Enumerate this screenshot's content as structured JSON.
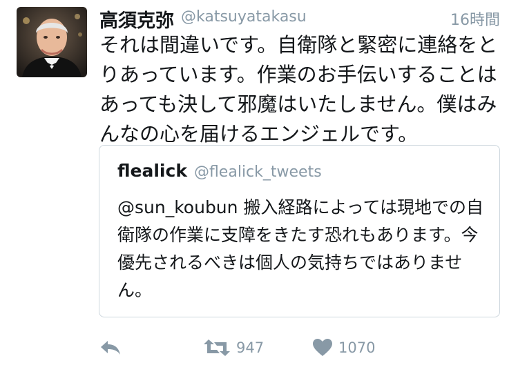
{
  "tweet": {
    "display_name": "高須克弥",
    "screen_name": "@katsuyatakasu",
    "timestamp": "16時間",
    "text": "それは間違いです。自衛隊と緊密に連絡をとりあっています。作業のお手伝いすることはあっても決して邪魔はいたしません。僕はみんなの心を届けるエンジェルです。"
  },
  "quoted_tweet": {
    "display_name": "flealick",
    "screen_name": "@flealick_tweets",
    "text": "@sun_koubun 搬入経路によっては現地での自衛隊の作業に支障をきたす恐れもあります。今優先されるべきは個人の気持ちではありません。"
  },
  "actions": {
    "reply_icon": "reply-icon",
    "retweet_icon": "retweet-icon",
    "retweet_count": "947",
    "like_icon": "heart-icon",
    "like_count": "1070"
  },
  "colors": {
    "text": "#14171a",
    "secondary": "#8899a6",
    "border": "#ccd6dd"
  }
}
